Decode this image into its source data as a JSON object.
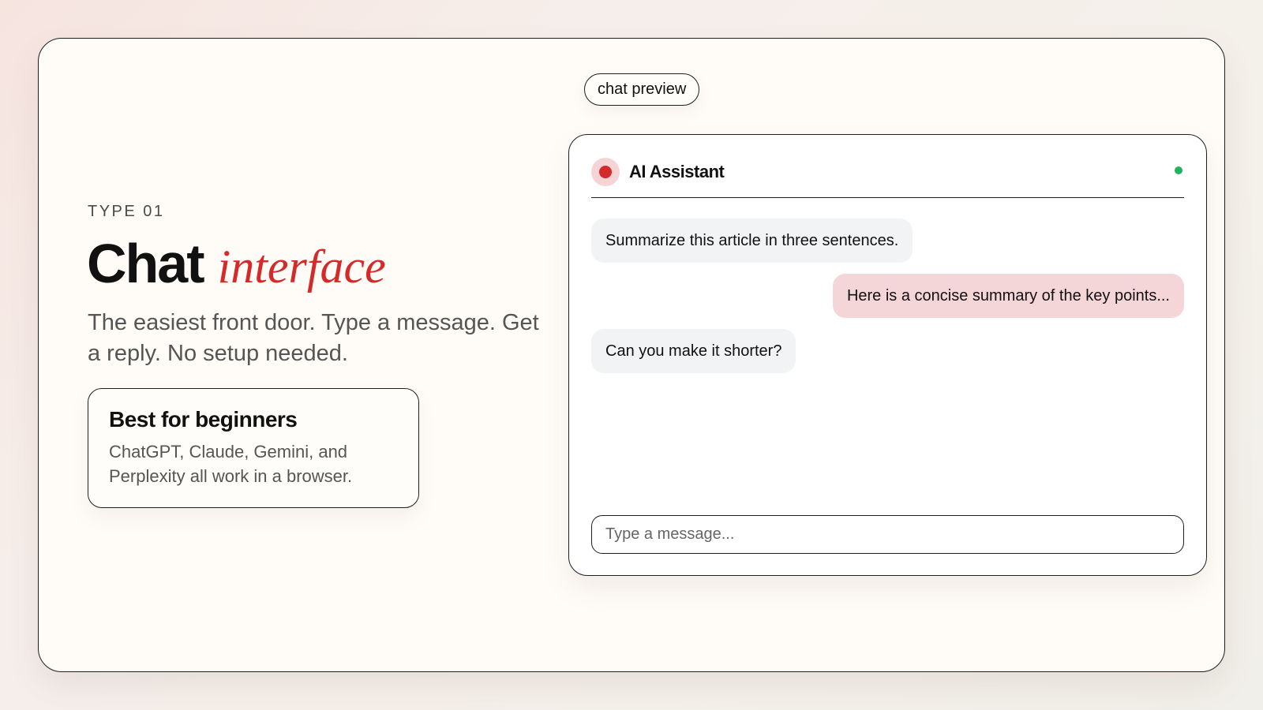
{
  "hero": {
    "eyebrow": "TYPE 01",
    "title_bold": "Chat",
    "title_script": "interface",
    "subtext": "The easiest front door. Type a message. Get a reply. No setup needed."
  },
  "callout": {
    "title": "Best for beginners",
    "body": "ChatGPT, Claude, Gemini, and Perplexity all work in a browser."
  },
  "preview_label": "chat preview",
  "chat": {
    "assistant_name": "AI Assistant",
    "status": "online",
    "messages": [
      {
        "role": "user",
        "text": "Summarize this article in three sentences."
      },
      {
        "role": "assistant",
        "text": "Here is a concise summary of the key points..."
      },
      {
        "role": "user",
        "text": "Can you make it shorter?"
      }
    ],
    "input_placeholder": "Type a message..."
  },
  "colors": {
    "accent": "#d42a2a",
    "assistant_bubble": "#f5d6d8",
    "user_bubble": "#f2f3f5",
    "online": "#22b35c"
  }
}
